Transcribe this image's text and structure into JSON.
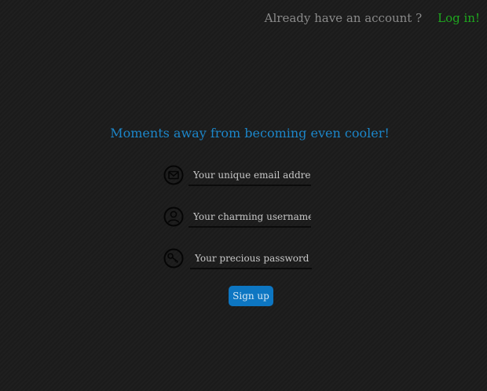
{
  "header": {
    "question": "Already have an account ?",
    "login_link": "Log in!"
  },
  "form": {
    "title": "Moments away from becoming even cooler!",
    "fields": [
      {
        "name": "email",
        "icon": "mail-icon",
        "placeholder": "Your unique email address",
        "value": ""
      },
      {
        "name": "username",
        "icon": "user-icon",
        "placeholder": "Your charming username",
        "value": ""
      },
      {
        "name": "password",
        "icon": "key-icon",
        "placeholder": "Your precious password",
        "value": ""
      }
    ],
    "submit_label": "Sign up"
  },
  "colors": {
    "background": "#1c1c1c",
    "title": "#1c86c9",
    "login_link": "#1fa81f",
    "muted_text": "#8a8a8a",
    "button": "#0d76c2"
  }
}
